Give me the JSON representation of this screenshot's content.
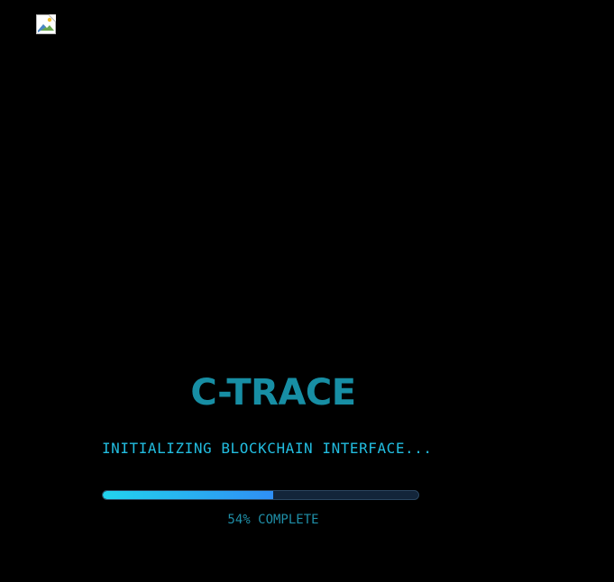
{
  "logo_image": {
    "icon": "broken-image-icon"
  },
  "loader": {
    "title": "C-TRACE",
    "status_text": "INITIALIZING BLOCKCHAIN INTERFACE...",
    "progress_percent": 54,
    "progress_label_value": "54%",
    "progress_label_suffix": "COMPLETE"
  },
  "colors": {
    "background": "#000000",
    "title": "#178ea4",
    "status": "#22bde0",
    "progress_start": "#22d3ee",
    "progress_end": "#2f8ff5",
    "track": "#13253a"
  }
}
